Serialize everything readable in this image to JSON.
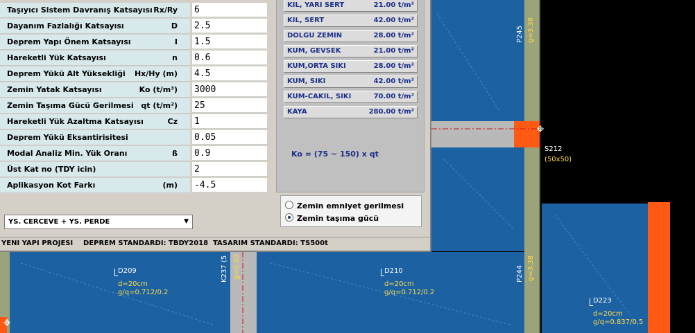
{
  "parameters": [
    {
      "label": "Taşıyıcı Sistem Davranış Katsayısı",
      "symbol": "Rx/Ry",
      "value": "6"
    },
    {
      "label": "Dayanım Fazlalığı Katsayısı",
      "symbol": "D",
      "value": "2.5"
    },
    {
      "label": "Deprem Yapı Önem Katsayısı",
      "symbol": "I",
      "value": "1.5"
    },
    {
      "label": "Hareketli Yük Katsayısı",
      "symbol": "n",
      "value": "0.6"
    },
    {
      "label": "Deprem Yükü Alt Yüksekliği",
      "symbol": "Hx/Hy  (m)",
      "value": "4.5"
    },
    {
      "label": "Zemin Yatak Katsayısı",
      "symbol": "Ko  (t/m³)",
      "value": "3000"
    },
    {
      "label": "Zemin Taşıma Gücü Gerilmesi",
      "symbol": "qt  (t/m²)",
      "value": "25"
    },
    {
      "label": "Hareketli Yük Azaltma Katsayısı",
      "symbol": "Cz",
      "value": "1"
    },
    {
      "label": "Deprem Yükü Eksantirisitesi",
      "symbol": "",
      "value": "0.05"
    },
    {
      "label": "Modal Analiz Min. Yük Oranı",
      "symbol": "ß",
      "value": "0.9"
    },
    {
      "label": "Üst Kat no (TDY icin)",
      "symbol": "",
      "value": "2"
    },
    {
      "label": "Aplikasyon Kot Farkı",
      "symbol": "(m)",
      "value": "-4.5"
    }
  ],
  "system_select": {
    "value": "YS. CERCEVE + YS. PERDE",
    "arrow": "▼"
  },
  "soil_types": [
    {
      "name": "KIL, YARI SERT",
      "value": "21.00 t/m²"
    },
    {
      "name": "KIL, SERT",
      "value": "42.00 t/m²"
    },
    {
      "name": "DOLGU  ZEMIN",
      "value": "28.00 t/m²"
    },
    {
      "name": "KUM, GEVSEK",
      "value": "21.00 t/m²"
    },
    {
      "name": "KUM,ORTA SIKI",
      "value": "28.00 t/m²"
    },
    {
      "name": "KUM, SIKI",
      "value": "42.00 t/m²"
    },
    {
      "name": "KUM-CAKIL, SIKI",
      "value": "70.00 t/m²"
    },
    {
      "name": "KAYA",
      "value": "280.00 t/m²"
    }
  ],
  "formula": "Ko = (75 ~ 150) x qt",
  "radio": {
    "option1": "Zemin emniyet gerilmesi",
    "option2": "Zemin taşıma gücü",
    "selected": 2
  },
  "status": {
    "project": "YENI YAPI PROJESI",
    "deprem": "DEPREM STANDARDI: TBDY2018",
    "tasarim": "TASARIM STANDARDI: TS500t"
  },
  "cad": {
    "p245": "P245",
    "g338a": "g=3.38",
    "p244": "P244",
    "g338b": "g=3.38",
    "s212": "S212",
    "s212_dim": "(50x50)",
    "k237": "K237 (5",
    "g088": "g=0.88",
    "d209": "D209",
    "d209_d": "d=20cm",
    "d209_gq": "g/q=0.712/0.2",
    "d210": "D210",
    "d210_d": "d=20cm",
    "d210_gq": "g/q=0.712/0.2",
    "d223": "D223",
    "d223_d": "d=20cm",
    "d223_gq": "g/q=0.837/0.5"
  },
  "colors": {
    "slab": "#1c62a3",
    "column": "#ff5a14",
    "beam": "#b9b9b9",
    "panel_text": "#1d2f8a"
  }
}
